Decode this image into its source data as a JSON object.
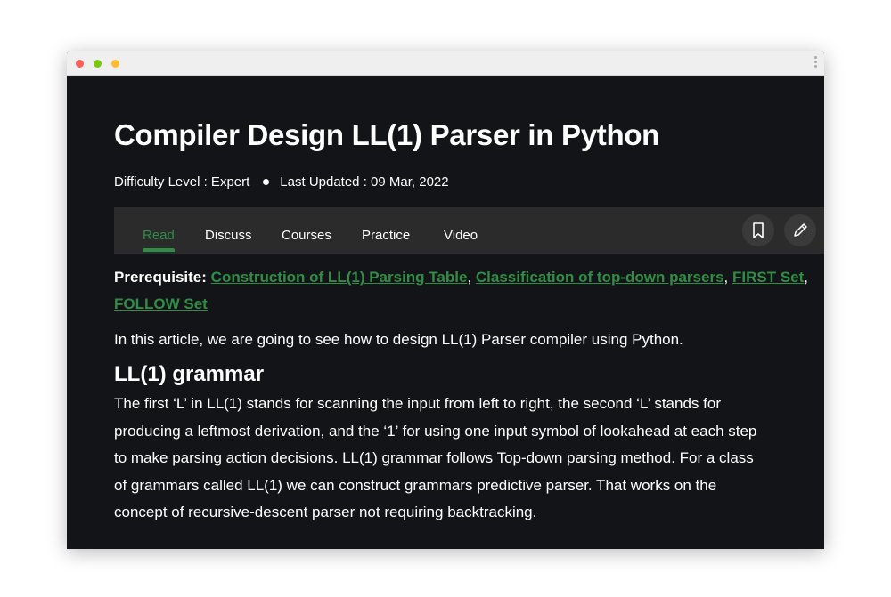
{
  "window": {
    "dots": [
      "#ff5f57",
      "#7ac70c",
      "#ffbd2e"
    ]
  },
  "article": {
    "title": "Compiler Design LL(1) Parser in Python",
    "difficulty": "Difficulty Level : Expert",
    "updated": "Last Updated : 09 Mar, 2022"
  },
  "tabs": [
    {
      "label": "Read",
      "active": true
    },
    {
      "label": "Discuss"
    },
    {
      "label": "Courses"
    },
    {
      "label": "Practice"
    },
    {
      "label": "Video"
    }
  ],
  "actions": {
    "bookmark": "bookmark-icon",
    "edit": "pencil-icon"
  },
  "prereq": {
    "label": "Prerequisite:",
    "links": [
      "Construction of LL(1) Parsing Table",
      "Classification of top-down parsers",
      "FIRST Set",
      "FOLLOW Set"
    ]
  },
  "intro": "In this article, we are going to see how to design LL(1) Parser compiler using Python.",
  "section": {
    "heading": "LL(1) grammar",
    "lines": [
      "The first ‘L’ in LL(1) stands for scanning the input from left to right, the second ‘L’ stands for",
      "producing a leftmost derivation, and the ‘1’ for using one input symbol of lookahead at each step",
      "to make parsing action decisions. LL(1) grammar follows Top-down parsing method. For a class",
      "of grammars called LL(1) we can construct grammars predictive parser. That works on the",
      "concept of recursive-descent parser not requiring backtracking."
    ]
  },
  "colors": {
    "accent": "#2f8d46",
    "background": "#131417",
    "tabbar": "#2b2b2b"
  }
}
